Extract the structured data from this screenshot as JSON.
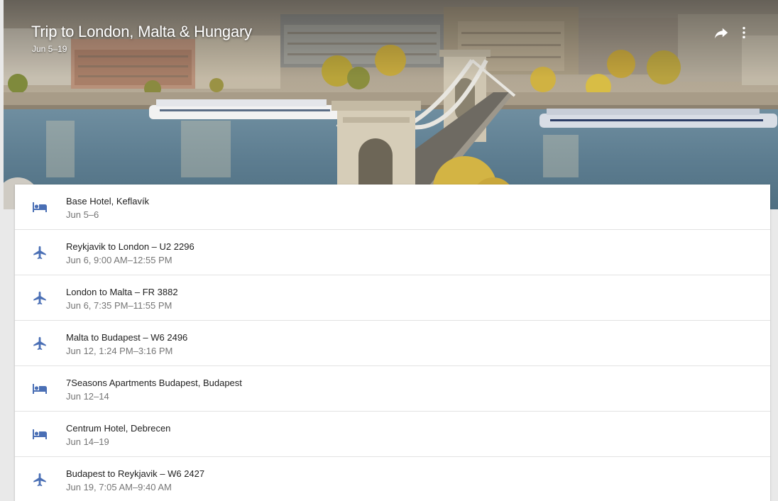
{
  "trip": {
    "title": "Trip to London, Malta & Hungary",
    "dates": "Jun 5–19"
  },
  "toolbar": {
    "share_icon": "share-icon",
    "more_icon": "more-vert-icon"
  },
  "colors": {
    "icon_accent": "#4a6fb5",
    "title_text": "#212121",
    "secondary_text": "#757575"
  },
  "items": [
    {
      "type": "hotel",
      "icon": "bed-icon",
      "title": "Base Hotel, Keflavík",
      "subtitle": "Jun 5–6"
    },
    {
      "type": "flight",
      "icon": "flight-icon",
      "title": "Reykjavik to London – U2 2296",
      "subtitle": "Jun 6, 9:00 AM–12:55 PM"
    },
    {
      "type": "flight",
      "icon": "flight-icon",
      "title": "London to Malta – FR 3882",
      "subtitle": "Jun 6, 7:35 PM–11:55 PM"
    },
    {
      "type": "flight",
      "icon": "flight-icon",
      "title": "Malta to Budapest – W6 2496",
      "subtitle": "Jun 12, 1:24 PM–3:16 PM"
    },
    {
      "type": "hotel",
      "icon": "bed-icon",
      "title": "7Seasons Apartments Budapest, Budapest",
      "subtitle": "Jun 12–14"
    },
    {
      "type": "hotel",
      "icon": "bed-icon",
      "title": "Centrum Hotel, Debrecen",
      "subtitle": "Jun 14–19"
    },
    {
      "type": "flight",
      "icon": "flight-icon",
      "title": "Budapest to Reykjavik – W6 2427",
      "subtitle": "Jun 19, 7:05 AM–9:40 AM"
    }
  ]
}
